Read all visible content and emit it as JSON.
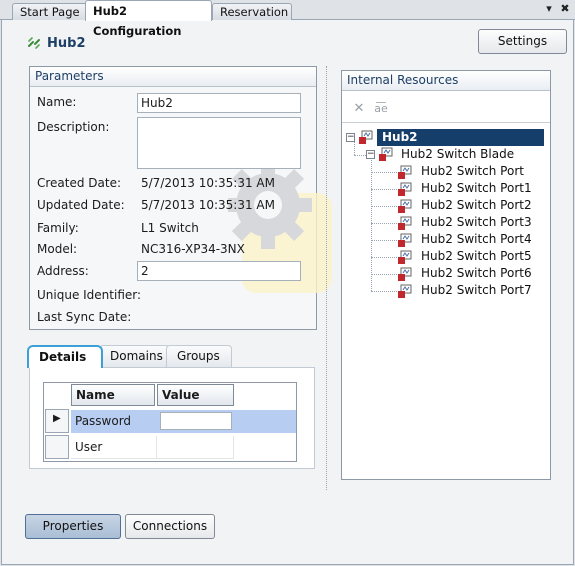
{
  "tabs": [
    {
      "label": "Start Page"
    },
    {
      "label": "Hub2 Configuration",
      "active": true
    },
    {
      "label": "Reservation"
    }
  ],
  "window_controls": {
    "dropdown_glyph": "▾",
    "close_glyph": "✖"
  },
  "header": {
    "title": "Hub2",
    "icon": "hub-icon",
    "settings_label": "Settings"
  },
  "parameters": {
    "title": "Parameters",
    "fields": {
      "name": {
        "label": "Name:",
        "value": "Hub2"
      },
      "description": {
        "label": "Description:",
        "value": ""
      },
      "created": {
        "label": "Created Date:",
        "value": "5/7/2013 10:35:31 AM"
      },
      "updated": {
        "label": "Updated Date:",
        "value": "5/7/2013 10:35:31 AM"
      },
      "family": {
        "label": "Family:",
        "value": "L1 Switch"
      },
      "model": {
        "label": "Model:",
        "value": "NC316-XP34-3NX"
      },
      "address": {
        "label": "Address:",
        "value": "2"
      },
      "unique_id": {
        "label": "Unique Identifier:",
        "value": ""
      },
      "last_sync": {
        "label": "Last Sync Date:",
        "value": ""
      }
    }
  },
  "internal_resources": {
    "title": "Internal Resources",
    "toolbar": {
      "delete_icon": "delete-icon",
      "rename_icon": "rename-icon",
      "rename_glyph": "a͞e"
    },
    "tree": {
      "root": {
        "label": "Hub2",
        "expander": "⊟",
        "selected": true
      },
      "blade": {
        "label": "Hub2 Switch Blade",
        "expander": "⊟"
      },
      "ports": [
        {
          "label": "Hub2 Switch Port"
        },
        {
          "label": "Hub2 Switch Port1"
        },
        {
          "label": "Hub2 Switch Port2"
        },
        {
          "label": "Hub2 Switch Port3"
        },
        {
          "label": "Hub2 Switch Port4"
        },
        {
          "label": "Hub2 Switch Port5"
        },
        {
          "label": "Hub2 Switch Port6"
        },
        {
          "label": "Hub2 Switch Port7"
        }
      ]
    }
  },
  "detail_tabs": [
    {
      "label": "Details",
      "active": true
    },
    {
      "label": "Domains"
    },
    {
      "label": "Groups"
    }
  ],
  "grid": {
    "columns": [
      "Name",
      "Value"
    ],
    "rows": [
      {
        "name": "Password",
        "value": "",
        "selected": true,
        "indicator": "▶"
      },
      {
        "name": "User",
        "value": ""
      }
    ]
  },
  "footer": {
    "properties_label": "Properties",
    "connections_label": "Connections"
  },
  "colors": {
    "selection": "#163e6b",
    "accent_tab": "#3c9fd8",
    "title_text": "#1e3f66",
    "row_highlight": "#b8cdf2"
  }
}
